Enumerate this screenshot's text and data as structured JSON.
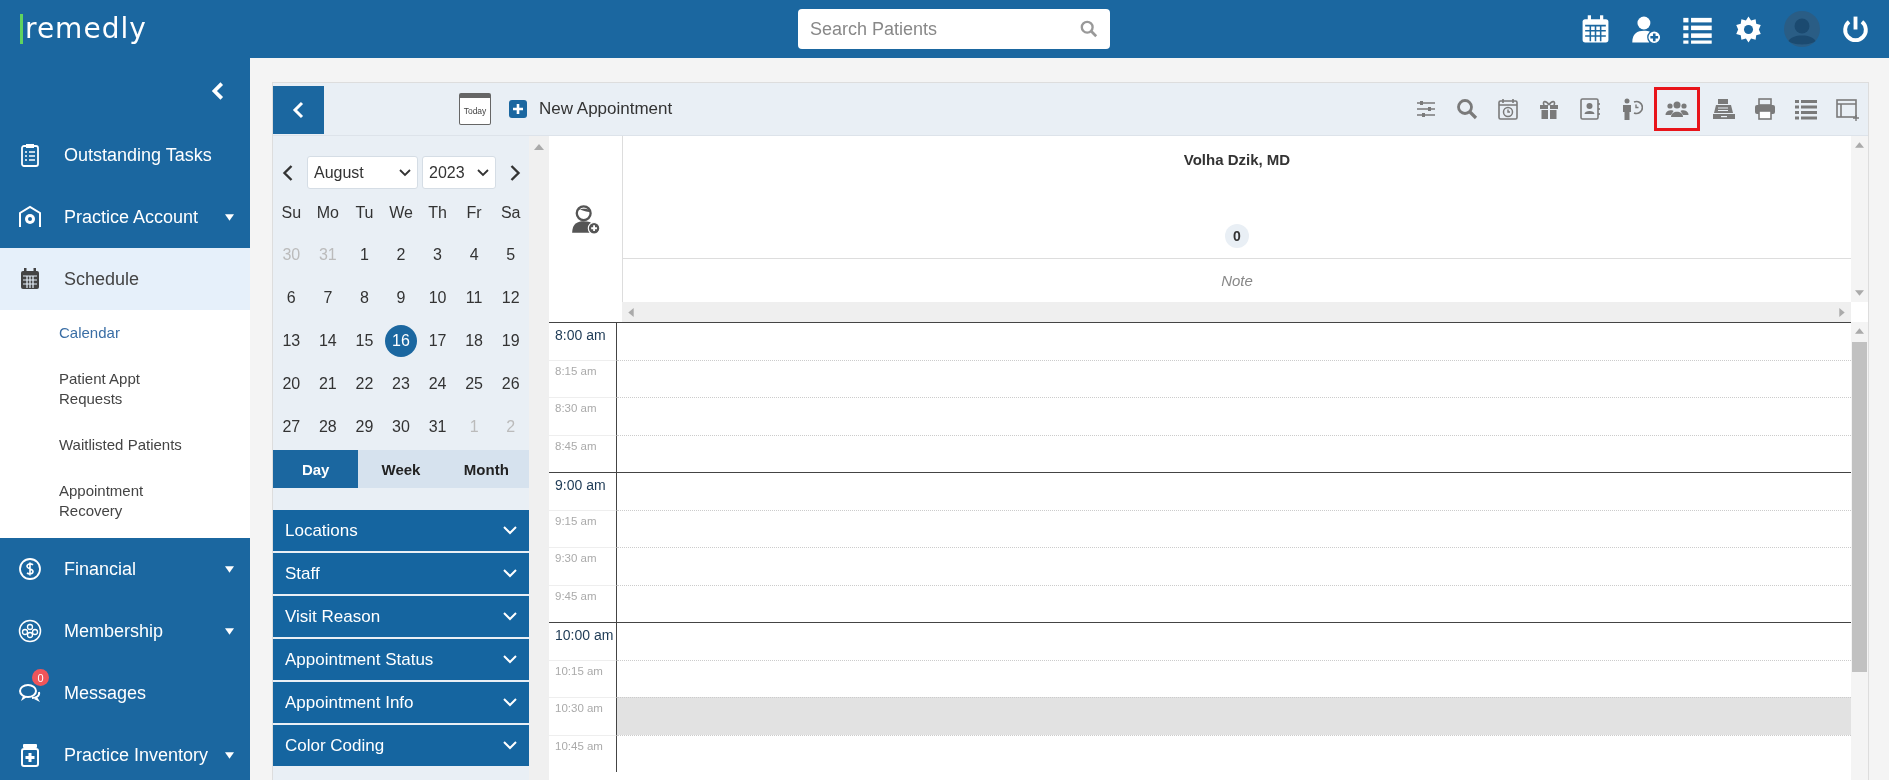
{
  "app": {
    "logo": "remedly",
    "search": {
      "placeholder": "Search Patients"
    }
  },
  "sidebar": {
    "items": [
      {
        "label": "Outstanding Tasks",
        "selected": false,
        "has_menu": false
      },
      {
        "label": "Practice Account",
        "selected": false,
        "has_menu": true
      },
      {
        "label": "Schedule",
        "selected": true,
        "has_menu": false,
        "children": [
          {
            "label": "Calendar",
            "selected": true
          },
          {
            "label": "Patient Appt Requests",
            "selected": false
          },
          {
            "label": "Waitlisted Patients",
            "selected": false
          },
          {
            "label": "Appointment Recovery",
            "selected": false
          }
        ]
      },
      {
        "label": "Financial",
        "selected": false,
        "has_menu": true
      },
      {
        "label": "Membership",
        "selected": false,
        "has_menu": true
      },
      {
        "label": "Messages",
        "selected": false,
        "has_menu": false,
        "badge": "0"
      },
      {
        "label": "Practice Inventory",
        "selected": false,
        "has_menu": true
      }
    ]
  },
  "toolbar": {
    "new_appointment": "New Appointment",
    "today": "Today",
    "tools": [
      {
        "highlighted": false
      },
      {
        "highlighted": false
      },
      {
        "highlighted": false
      },
      {
        "highlighted": false
      },
      {
        "highlighted": false
      },
      {
        "highlighted": false
      },
      {
        "highlighted": true
      },
      {
        "highlighted": false
      },
      {
        "highlighted": false
      },
      {
        "highlighted": false
      },
      {
        "highlighted": false
      }
    ]
  },
  "calendar": {
    "month": "August",
    "year": "2023",
    "weekdays": [
      "Su",
      "Mo",
      "Tu",
      "We",
      "Th",
      "Fr",
      "Sa"
    ],
    "weeks": [
      [
        {
          "day": "30",
          "outside": true,
          "selected": false
        },
        {
          "day": "31",
          "outside": true,
          "selected": false
        },
        {
          "day": "1",
          "outside": false,
          "selected": false
        },
        {
          "day": "2",
          "outside": false,
          "selected": false
        },
        {
          "day": "3",
          "outside": false,
          "selected": false
        },
        {
          "day": "4",
          "outside": false,
          "selected": false
        },
        {
          "day": "5",
          "outside": false,
          "selected": false
        }
      ],
      [
        {
          "day": "6",
          "outside": false,
          "selected": false
        },
        {
          "day": "7",
          "outside": false,
          "selected": false
        },
        {
          "day": "8",
          "outside": false,
          "selected": false
        },
        {
          "day": "9",
          "outside": false,
          "selected": false
        },
        {
          "day": "10",
          "outside": false,
          "selected": false
        },
        {
          "day": "11",
          "outside": false,
          "selected": false
        },
        {
          "day": "12",
          "outside": false,
          "selected": false
        }
      ],
      [
        {
          "day": "13",
          "outside": false,
          "selected": false
        },
        {
          "day": "14",
          "outside": false,
          "selected": false
        },
        {
          "day": "15",
          "outside": false,
          "selected": false
        },
        {
          "day": "16",
          "outside": false,
          "selected": true
        },
        {
          "day": "17",
          "outside": false,
          "selected": false
        },
        {
          "day": "18",
          "outside": false,
          "selected": false
        },
        {
          "day": "19",
          "outside": false,
          "selected": false
        }
      ],
      [
        {
          "day": "20",
          "outside": false,
          "selected": false
        },
        {
          "day": "21",
          "outside": false,
          "selected": false
        },
        {
          "day": "22",
          "outside": false,
          "selected": false
        },
        {
          "day": "23",
          "outside": false,
          "selected": false
        },
        {
          "day": "24",
          "outside": false,
          "selected": false
        },
        {
          "day": "25",
          "outside": false,
          "selected": false
        },
        {
          "day": "26",
          "outside": false,
          "selected": false
        }
      ],
      [
        {
          "day": "27",
          "outside": false,
          "selected": false
        },
        {
          "day": "28",
          "outside": false,
          "selected": false
        },
        {
          "day": "29",
          "outside": false,
          "selected": false
        },
        {
          "day": "30",
          "outside": false,
          "selected": false
        },
        {
          "day": "31",
          "outside": false,
          "selected": false
        },
        {
          "day": "1",
          "outside": true,
          "selected": false
        },
        {
          "day": "2",
          "outside": true,
          "selected": false
        }
      ]
    ],
    "views": [
      {
        "label": "Day",
        "selected": true
      },
      {
        "label": "Week",
        "selected": false
      },
      {
        "label": "Month",
        "selected": false
      }
    ],
    "filters": [
      "Locations",
      "Staff",
      "Visit Reason",
      "Appointment Status",
      "Appointment Info",
      "Color Coding"
    ]
  },
  "schedule": {
    "provider": "Volha Dzik, MD",
    "count": "0",
    "note": "Note",
    "slots": [
      {
        "label": "8:00 am",
        "kind": "hour",
        "shaded": false
      },
      {
        "label": "8:15 am",
        "kind": "quarter",
        "shaded": false
      },
      {
        "label": "8:30 am",
        "kind": "quarter",
        "shaded": false
      },
      {
        "label": "8:45 am",
        "kind": "quarter",
        "shaded": false
      },
      {
        "label": "9:00 am",
        "kind": "hour",
        "shaded": false
      },
      {
        "label": "9:15 am",
        "kind": "quarter",
        "shaded": false
      },
      {
        "label": "9:30 am",
        "kind": "quarter",
        "shaded": false
      },
      {
        "label": "9:45 am",
        "kind": "quarter",
        "shaded": false
      },
      {
        "label": "10:00 am",
        "kind": "hour",
        "shaded": false
      },
      {
        "label": "10:15 am",
        "kind": "quarter",
        "shaded": false
      },
      {
        "label": "10:30 am",
        "kind": "quarter",
        "shaded": true
      },
      {
        "label": "10:45 am",
        "kind": "quarter",
        "shaded": false
      }
    ]
  }
}
